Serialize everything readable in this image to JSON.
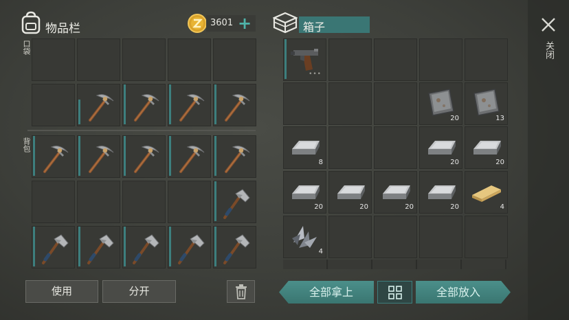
{
  "inventory": {
    "title": "物品栏",
    "pocket_label": "口袋",
    "backpack_label": "背包",
    "coins": "3601",
    "add_coins_icon": "plus-icon",
    "use_label": "使用",
    "split_label": "分开",
    "trash_icon": "trash-icon"
  },
  "box": {
    "title": "箱子",
    "take_all_label": "全部拿上",
    "put_all_label": "全部放入",
    "sort_icon": "grid-sort-icon",
    "items": {
      "pistol": {
        "count": ""
      },
      "iron_plate_1": {
        "count": "20"
      },
      "iron_plate_2": {
        "count": "13"
      },
      "ingot_1": {
        "count": "8"
      },
      "ingot_2": {
        "count": "20"
      },
      "ingot_3": {
        "count": "20"
      },
      "ingot_4": {
        "count": "20"
      },
      "ingot_5": {
        "count": "20"
      },
      "ingot_6": {
        "count": "20"
      },
      "ingot_7": {
        "count": "20"
      },
      "plank": {
        "count": "4"
      },
      "shards": {
        "count": "4"
      }
    }
  },
  "close": {
    "label": "关闭",
    "icon": "close-icon"
  },
  "colors": {
    "accent": "#3d8a85",
    "durability": "#3d7f7e"
  }
}
